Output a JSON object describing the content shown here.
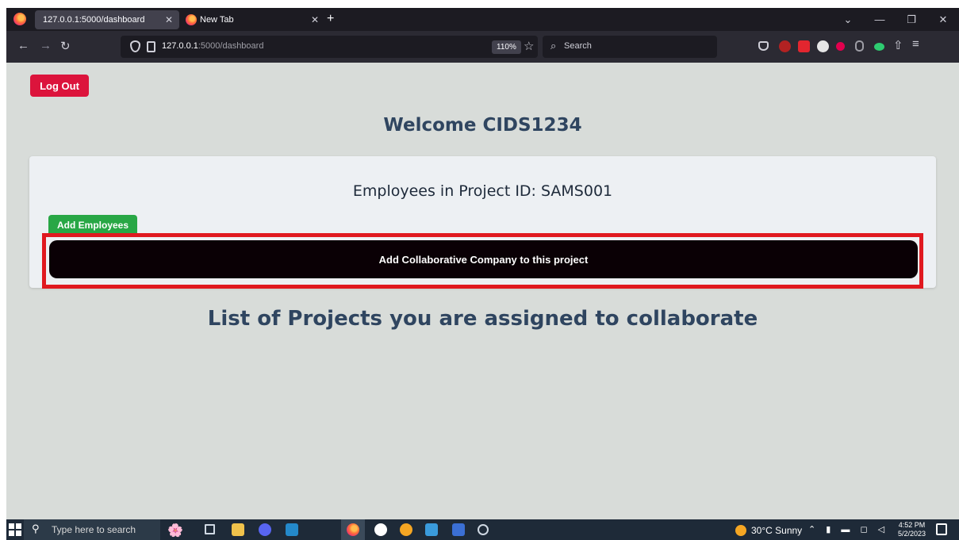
{
  "browser": {
    "tabs": [
      {
        "label": "127.0.0.1:5000/dashboard",
        "active": true
      },
      {
        "label": "New Tab",
        "active": false
      }
    ],
    "url_host": "127.0.0.1",
    "url_path": ":5000/dashboard",
    "zoom": "110%",
    "search_placeholder": "Search"
  },
  "page": {
    "logout_label": "Log Out",
    "welcome": "Welcome CIDS1234",
    "card_title": "Employees in Project ID: SAMS001",
    "add_employees_label": "Add Employees",
    "add_collab_label": "Add Collaborative Company to this project",
    "list_heading": "List of Projects you are assigned to collaborate",
    "colors": {
      "background": "#d8dcd9",
      "danger": "#dc143c",
      "success": "#28a745",
      "heading": "#2f4560",
      "highlight": "#e0191f"
    }
  },
  "taskbar": {
    "search_placeholder": "Type here to search",
    "weather": "30°C Sunny",
    "time": "4:52 PM",
    "date": "5/2/2023"
  }
}
